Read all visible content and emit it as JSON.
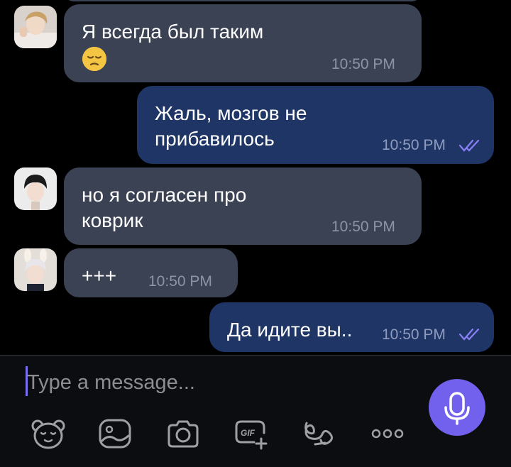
{
  "messages": [
    {
      "id": "m1",
      "direction": "incoming",
      "text": "Я всегда был таким",
      "emoji": "pensive-face",
      "time": "10:50 PM"
    },
    {
      "id": "m2",
      "direction": "outgoing",
      "text": "Жаль, мозгов не\nприбавилось",
      "time": "10:50 PM",
      "status": "read"
    },
    {
      "id": "m3",
      "direction": "incoming",
      "text": "но я согласен про\nковрик",
      "time": "10:50 PM"
    },
    {
      "id": "m4",
      "direction": "incoming",
      "text": "+++",
      "time": "10:50 PM"
    },
    {
      "id": "m5",
      "direction": "outgoing",
      "text": "Да идите вы..",
      "time": "10:50 PM",
      "status": "read"
    }
  ],
  "composer": {
    "placeholder": "Type a message...",
    "mic_icon": "microphone-icon",
    "toolbar_icons": [
      "sticker-bear-icon",
      "image-icon",
      "camera-icon",
      "gif-icon",
      "doodle-icon",
      "more-icon"
    ]
  },
  "colors": {
    "background": "#000000",
    "incoming_bubble": "#3b4253",
    "outgoing_bubble": "#1e3566",
    "accent": "#7161ec",
    "read_ticks": "#8a7ff5"
  }
}
